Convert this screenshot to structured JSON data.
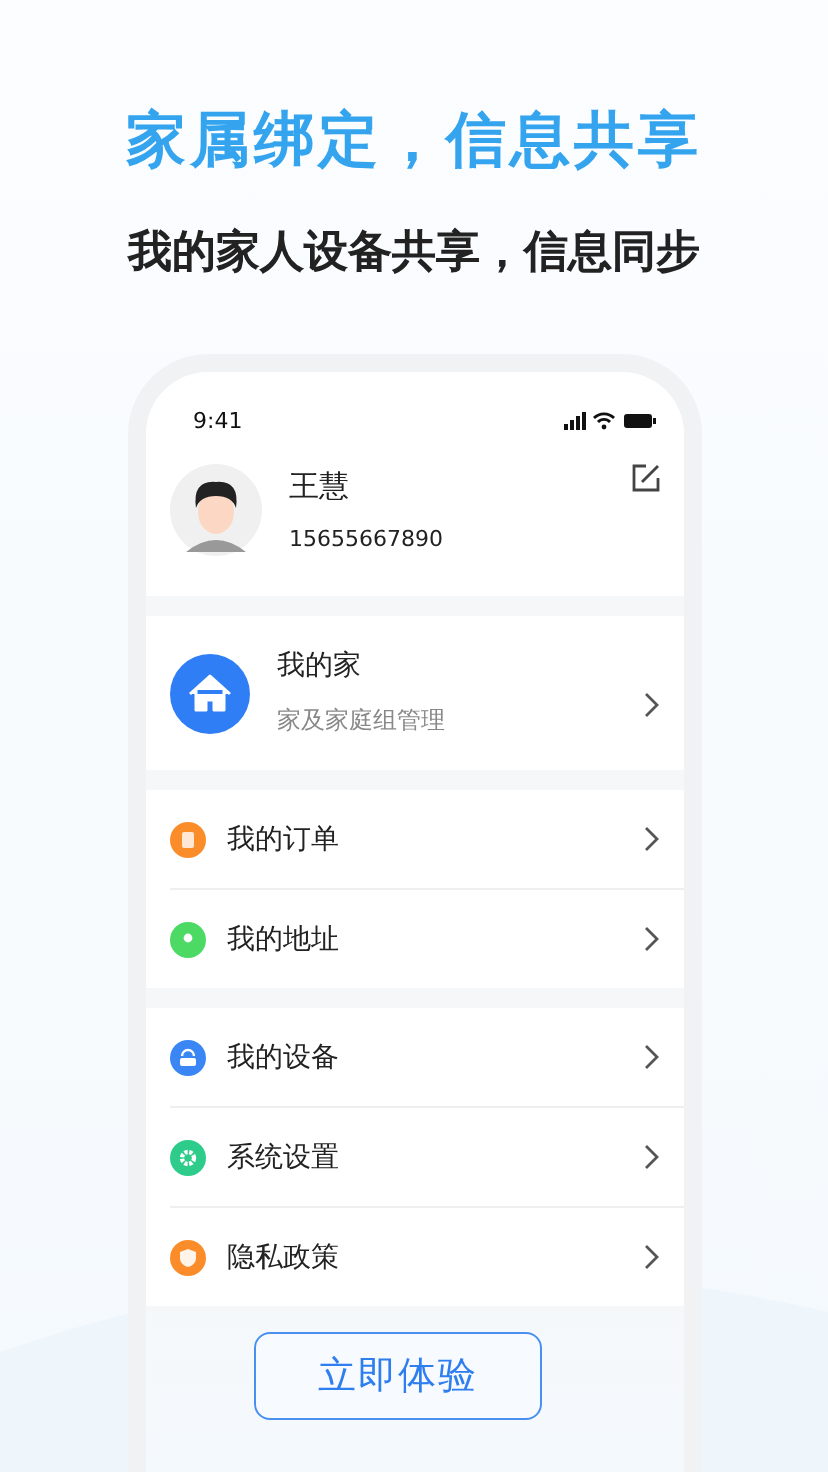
{
  "headline": "家属绑定，信息共享",
  "subheadline": "我的家人设备共享，信息同步",
  "status_bar": {
    "time": "9:41"
  },
  "profile": {
    "name": "王慧",
    "phone": "15655667890"
  },
  "family": {
    "title": "我的家",
    "subtitle": "家及家庭组管理"
  },
  "menu_groups": [
    [
      {
        "label": "我的订单",
        "color": "#fb8c2a"
      },
      {
        "label": "我的地址",
        "color": "#4cd964"
      }
    ],
    [
      {
        "label": "我的设备",
        "color": "#3a86f5"
      },
      {
        "label": "系统设置",
        "color": "#2ecc8a"
      },
      {
        "label": "隐私政策",
        "color": "#fb8c2a"
      }
    ]
  ],
  "cta_button": "立即体验"
}
